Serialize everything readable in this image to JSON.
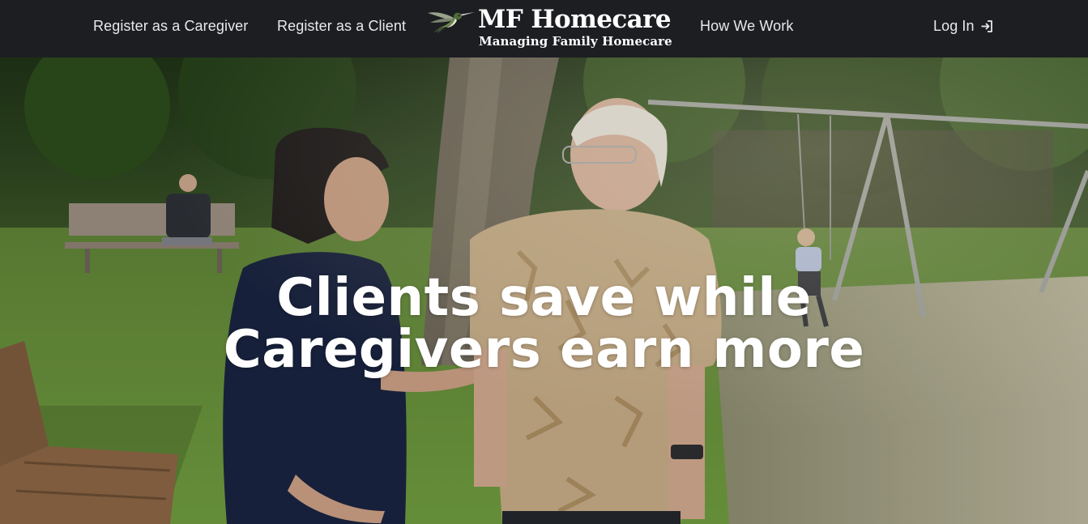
{
  "nav": {
    "register_caregiver": "Register as a Caregiver",
    "register_client": "Register as a Client",
    "how_we_work": "How We Work",
    "login": "Log In"
  },
  "brand": {
    "title": "MF Homecare",
    "subtitle": "Managing Family Homecare"
  },
  "hero": {
    "headline": "Clients save while Caregivers earn more"
  },
  "colors": {
    "navbar_bg": "#1d1e22",
    "nav_text": "#e9e9ea",
    "headline_text": "#ffffff"
  },
  "icons": {
    "logo": "hummingbird-icon",
    "login": "sign-in-icon"
  }
}
